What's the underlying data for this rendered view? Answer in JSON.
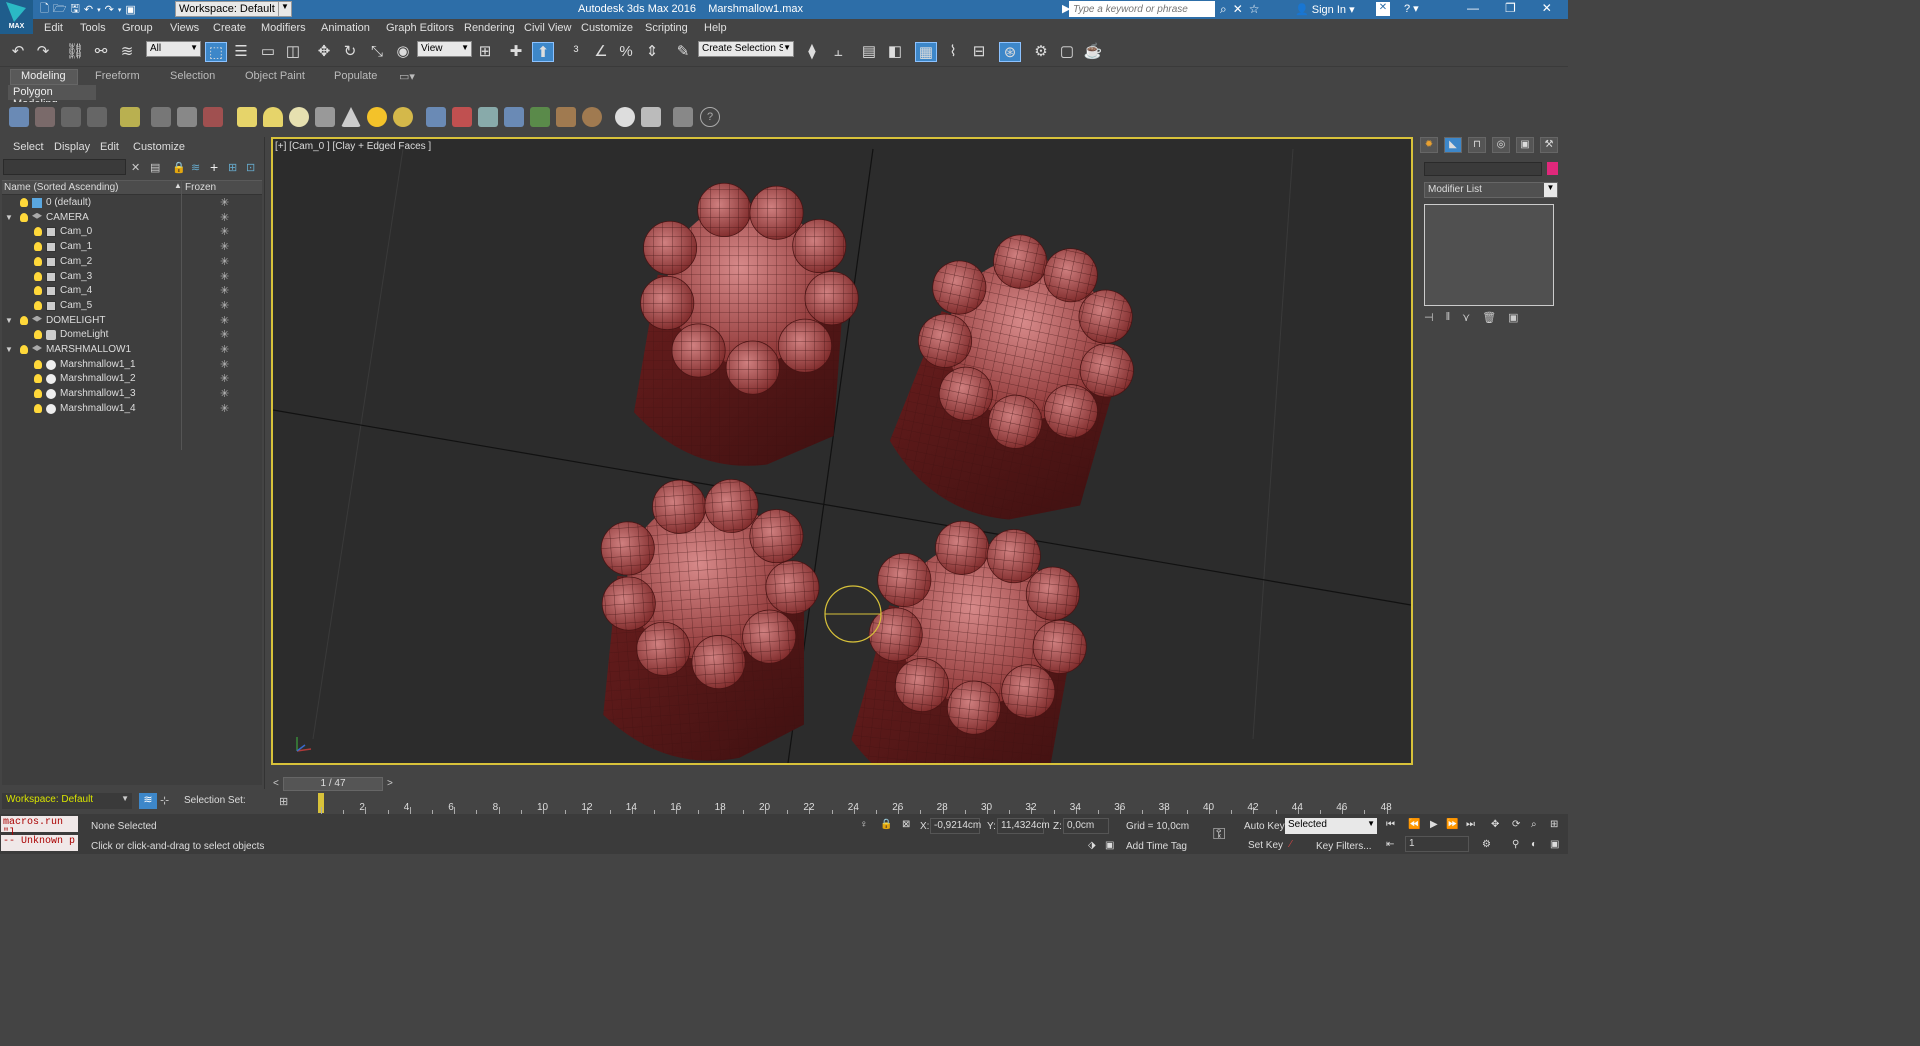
{
  "app": {
    "title": "Autodesk 3ds Max 2016",
    "file": "Marshmallow1.max",
    "logo": "MAX"
  },
  "quick_access": {
    "workspace": "Workspace: Default"
  },
  "search": {
    "placeholder": "Type a keyword or phrase"
  },
  "signin": "Sign In",
  "menu": [
    "Edit",
    "Tools",
    "Group",
    "Views",
    "Create",
    "Modifiers",
    "Animation",
    "Graph Editors",
    "Rendering",
    "Civil View",
    "Customize",
    "Scripting",
    "Help"
  ],
  "toolbar": {
    "selection_filter": "All",
    "ref_coord": "View",
    "named_selection": "Create Selection Se"
  },
  "ribbon": {
    "tabs": [
      "Modeling",
      "Freeform",
      "Selection",
      "Object Paint",
      "Populate"
    ],
    "active": "Modeling",
    "panel": "Polygon Modeling"
  },
  "scene_explorer": {
    "menu": [
      "Select",
      "Display",
      "Edit",
      "Customize"
    ],
    "col_name": "Name (Sorted Ascending)",
    "col_frozen": "Frozen",
    "rows": [
      {
        "label": "0 (default)",
        "level": 0,
        "type": "layer-default"
      },
      {
        "label": "CAMERA",
        "level": 0,
        "type": "layer"
      },
      {
        "label": "Cam_0",
        "level": 1,
        "type": "camera"
      },
      {
        "label": "Cam_1",
        "level": 1,
        "type": "camera"
      },
      {
        "label": "Cam_2",
        "level": 1,
        "type": "camera"
      },
      {
        "label": "Cam_3",
        "level": 1,
        "type": "camera"
      },
      {
        "label": "Cam_4",
        "level": 1,
        "type": "camera"
      },
      {
        "label": "Cam_5",
        "level": 1,
        "type": "camera"
      },
      {
        "label": "DOMELIGHT",
        "level": 0,
        "type": "layer"
      },
      {
        "label": "DomeLight",
        "level": 1,
        "type": "light"
      },
      {
        "label": "MARSHMALLOW1",
        "level": 0,
        "type": "layer"
      },
      {
        "label": "Marshmallow1_1",
        "level": 1,
        "type": "geometry"
      },
      {
        "label": "Marshmallow1_2",
        "level": 1,
        "type": "geometry"
      },
      {
        "label": "Marshmallow1_3",
        "level": 1,
        "type": "geometry"
      },
      {
        "label": "Marshmallow1_4",
        "level": 1,
        "type": "geometry"
      }
    ]
  },
  "viewport": {
    "label": "[+] [Cam_0 ] [Clay + Edged Faces ]"
  },
  "command_panel": {
    "modifier_list": "Modifier List",
    "object_color": "#e0287b"
  },
  "time": {
    "slider": "1 / 47",
    "ticks": [
      "2",
      "4",
      "6",
      "8",
      "10",
      "12",
      "14",
      "16",
      "18",
      "20",
      "22",
      "24",
      "26",
      "28",
      "30",
      "32",
      "34",
      "36",
      "38",
      "40",
      "42",
      "44",
      "46",
      "48"
    ]
  },
  "status": {
    "workspace": "Workspace: Default",
    "selection_set": "Selection Set:",
    "maxscript1": "macros.run \"]",
    "maxscript2": "-- Unknown p",
    "selected": "None Selected",
    "prompt": "Click or click-and-drag to select objects",
    "x_label": "X:",
    "x": "-0,9214cm",
    "y_label": "Y:",
    "y": "11,4324cm",
    "z_label": "Z:",
    "z": "0,0cm",
    "grid": "Grid = 10,0cm",
    "add_time_tag": "Add Time Tag",
    "auto_key": "Auto Key",
    "set_key": "Set Key",
    "key_mode": "Selected",
    "key_filters": "Key Filters...",
    "frame": "1"
  }
}
